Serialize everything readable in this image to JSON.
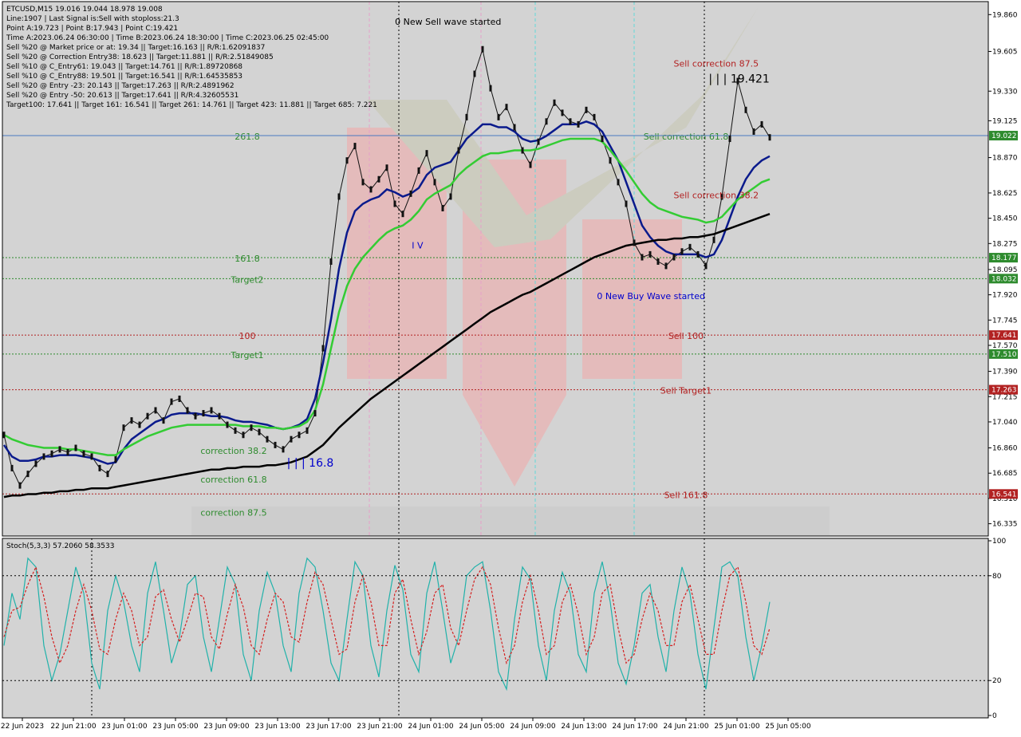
{
  "header": {
    "symbol_line": "ETCUSD,M15  19.016 19.044 18.978 19.008",
    "info_lines": [
      "Line:1907 | Last Signal is:Sell with stoploss:21.3",
      "Point A:19.723 | Point B:17.943 | Point C:19.421",
      "Time A:2023.06.24 06:30:00 | Time B:2023.06.24 18:30:00 | Time C:2023.06.25 02:45:00",
      "Sell %20 @ Market price or at: 19.34 || Target:16.163 || R/R:1.62091837",
      "Sell %20 @ Correction Entry38: 18.623 || Target:11.881 || R/R:2.51849085",
      "Sell %10 @ C_Entry61: 19.043 || Target:14.761 || R/R:1.89720868",
      "Sell %10 @ C_Entry88: 19.501 || Target:16.541 || R/R:1.64535853",
      "Sell %20 @ Entry -23: 20.143 || Target:17.263 || R/R:2.4891962",
      "Sell %20 @ Entry -50: 20.613 || Target:17.641 || R/R:4.32605531",
      "Target100: 17.641 || Target 161: 16.541 || Target 261: 14.761 || Target 423: 11.881 || Target 685: 7.221"
    ]
  },
  "colors": {
    "background": "#d3d3d3",
    "price_line": "#4a78c0",
    "sell_level": "#b22222",
    "buy_level": "#2e8b2e",
    "ma_fast": "#0a1a8c",
    "ma_mid": "#33cc33",
    "ma_slow": "#000000",
    "stoch_main": "#20b2aa",
    "stoch_signal": "#d42020"
  },
  "chart_data": [
    {
      "type": "line",
      "title": "ETCUSD,M15",
      "ylim": [
        16.25,
        19.95
      ],
      "y_ticks": [
        "19.860",
        "19.605",
        "19.330",
        "19.125",
        "18.870",
        "18.625",
        "18.450",
        "18.275",
        "18.095",
        "17.920",
        "17.745",
        "17.570",
        "17.390",
        "17.215",
        "17.040",
        "16.860",
        "16.685",
        "16.510",
        "16.335"
      ],
      "x_ticks": [
        "22 Jun 2023",
        "22 Jun 21:00",
        "23 Jun 01:00",
        "23 Jun 05:00",
        "23 Jun 09:00",
        "23 Jun 13:00",
        "23 Jun 17:00",
        "23 Jun 21:00",
        "24 Jun 01:00",
        "24 Jun 05:00",
        "24 Jun 09:00",
        "24 Jun 13:00",
        "24 Jun 17:00",
        "24 Jun 21:00",
        "25 Jun 01:00",
        "25 Jun 05:00"
      ],
      "current_price": 19.022,
      "price_tags": [
        {
          "value": 19.022,
          "label": "19.022",
          "kind": "buy"
        },
        {
          "value": 18.177,
          "label": "18.177",
          "kind": "buy"
        },
        {
          "value": 18.032,
          "label": "18.032",
          "kind": "buy"
        },
        {
          "value": 17.641,
          "label": "17.641",
          "kind": "sell"
        },
        {
          "value": 17.51,
          "label": "17.510",
          "kind": "buy"
        },
        {
          "value": 17.263,
          "label": "17.263",
          "kind": "sell"
        },
        {
          "value": 16.541,
          "label": "16.541",
          "kind": "sell"
        }
      ],
      "levels": [
        {
          "value": 19.022,
          "left_label": "261.8",
          "right_label": "Sell correction 61.8",
          "kind": "buy"
        },
        {
          "value": 18.177,
          "left_label": "161.8",
          "right_label": "",
          "kind": "buy"
        },
        {
          "value": 18.032,
          "left_label": "Target2",
          "right_label": "",
          "kind": "buy"
        },
        {
          "value": 17.641,
          "left_label": "100",
          "right_label": "Sell 100",
          "kind": "sell"
        },
        {
          "value": 17.51,
          "left_label": "Target1",
          "right_label": "",
          "kind": "buy"
        },
        {
          "value": 17.263,
          "left_label": "",
          "right_label": "Sell Target1",
          "kind": "sell"
        },
        {
          "value": 16.541,
          "left_label": "",
          "right_label": "Sell 161.8",
          "kind": "sell"
        }
      ],
      "annotations": [
        {
          "text": "0 New Sell wave started",
          "x": 58,
          "y": 19.79,
          "color": "#000000"
        },
        {
          "text": "Sell correction 87.5",
          "x": 93,
          "y": 19.5,
          "color": "#b22222"
        },
        {
          "text": "| | | 19.421",
          "x": 96,
          "y": 19.39,
          "color": "#000000"
        },
        {
          "text": "Sell correction 38.2",
          "x": 93,
          "y": 18.59,
          "color": "#b22222"
        },
        {
          "text": "0 New Buy Wave started",
          "x": 84.5,
          "y": 17.89,
          "color": "#0000cc"
        },
        {
          "text": "correction 38.2",
          "x": 30,
          "y": 16.82,
          "color": "#2e8b2e"
        },
        {
          "text": "correction 61.8",
          "x": 30,
          "y": 16.62,
          "color": "#2e8b2e"
        },
        {
          "text": "correction 87.5",
          "x": 30,
          "y": 16.39,
          "color": "#2e8b2e"
        },
        {
          "text": "| | | 16.8",
          "x": 40,
          "y": 16.73,
          "color": "#0000cc"
        },
        {
          "text": "I V",
          "x": 54,
          "y": 18.24,
          "color": "#0000cc"
        }
      ],
      "series": [
        {
          "name": "price",
          "values": [
            16.95,
            16.72,
            16.6,
            16.68,
            16.75,
            16.8,
            16.82,
            16.85,
            16.83,
            16.86,
            16.82,
            16.8,
            16.72,
            16.68,
            16.78,
            17.0,
            17.05,
            17.02,
            17.08,
            17.12,
            17.05,
            17.18,
            17.2,
            17.12,
            17.08,
            17.1,
            17.12,
            17.08,
            17.02,
            16.98,
            16.95,
            17.0,
            16.97,
            16.92,
            16.88,
            16.85,
            16.92,
            16.95,
            16.98,
            17.1,
            17.55,
            18.15,
            18.6,
            18.85,
            18.95,
            18.7,
            18.65,
            18.72,
            18.8,
            18.55,
            18.48,
            18.62,
            18.78,
            18.9,
            18.7,
            18.52,
            18.6,
            18.92,
            19.15,
            19.45,
            19.62,
            19.35,
            19.15,
            19.22,
            19.08,
            18.92,
            18.82,
            18.98,
            19.12,
            19.25,
            19.18,
            19.12,
            19.1,
            19.2,
            19.15,
            19.0,
            18.85,
            18.7,
            18.55,
            18.28,
            18.18,
            18.2,
            18.15,
            18.12,
            18.18,
            18.22,
            18.25,
            18.2,
            18.12,
            18.3,
            18.6,
            19.0,
            19.4,
            19.2,
            19.05,
            19.1,
            19.01
          ]
        },
        {
          "name": "ma_fast",
          "values": [
            16.88,
            16.8,
            16.77,
            16.77,
            16.78,
            16.8,
            16.8,
            16.81,
            16.81,
            16.81,
            16.8,
            16.79,
            16.77,
            16.75,
            16.76,
            16.85,
            16.92,
            16.96,
            17.0,
            17.04,
            17.06,
            17.09,
            17.1,
            17.1,
            17.1,
            17.09,
            17.08,
            17.08,
            17.07,
            17.05,
            17.04,
            17.04,
            17.03,
            17.02,
            17.0,
            16.99,
            17.0,
            17.02,
            17.06,
            17.2,
            17.45,
            17.75,
            18.1,
            18.35,
            18.5,
            18.55,
            18.58,
            18.6,
            18.65,
            18.63,
            18.6,
            18.62,
            18.66,
            18.75,
            18.8,
            18.82,
            18.84,
            18.92,
            19.0,
            19.05,
            19.1,
            19.1,
            19.08,
            19.08,
            19.05,
            19.0,
            18.98,
            18.99,
            19.02,
            19.06,
            19.1,
            19.1,
            19.1,
            19.12,
            19.1,
            19.05,
            18.95,
            18.85,
            18.7,
            18.55,
            18.4,
            18.32,
            18.26,
            18.22,
            18.2,
            18.2,
            18.2,
            18.2,
            18.18,
            18.2,
            18.3,
            18.45,
            18.6,
            18.72,
            18.8,
            18.85,
            18.88
          ]
        },
        {
          "name": "ma_mid",
          "values": [
            16.95,
            16.92,
            16.9,
            16.88,
            16.87,
            16.86,
            16.86,
            16.86,
            16.85,
            16.85,
            16.84,
            16.83,
            16.82,
            16.81,
            16.81,
            16.85,
            16.88,
            16.91,
            16.94,
            16.96,
            16.98,
            17.0,
            17.01,
            17.02,
            17.02,
            17.02,
            17.02,
            17.02,
            17.02,
            17.02,
            17.01,
            17.01,
            17.01,
            17.0,
            17.0,
            16.99,
            17.0,
            17.01,
            17.04,
            17.12,
            17.3,
            17.55,
            17.8,
            17.98,
            18.1,
            18.18,
            18.24,
            18.3,
            18.35,
            18.38,
            18.4,
            18.44,
            18.5,
            18.58,
            18.62,
            18.65,
            18.68,
            18.75,
            18.8,
            18.84,
            18.88,
            18.9,
            18.9,
            18.91,
            18.92,
            18.92,
            18.92,
            18.93,
            18.95,
            18.97,
            18.99,
            19.0,
            19.0,
            19.0,
            19.0,
            18.98,
            18.92,
            18.85,
            18.78,
            18.7,
            18.62,
            18.56,
            18.52,
            18.5,
            18.48,
            18.46,
            18.45,
            18.44,
            18.42,
            18.43,
            18.46,
            18.52,
            18.58,
            18.62,
            18.66,
            18.7,
            18.72
          ]
        },
        {
          "name": "ma_slow",
          "values": [
            16.52,
            16.53,
            16.53,
            16.54,
            16.54,
            16.55,
            16.55,
            16.56,
            16.56,
            16.57,
            16.57,
            16.58,
            16.58,
            16.58,
            16.59,
            16.6,
            16.61,
            16.62,
            16.63,
            16.64,
            16.65,
            16.66,
            16.67,
            16.68,
            16.69,
            16.7,
            16.71,
            16.71,
            16.72,
            16.72,
            16.73,
            16.73,
            16.73,
            16.74,
            16.74,
            16.75,
            16.76,
            16.78,
            16.8,
            16.84,
            16.88,
            16.94,
            17.0,
            17.05,
            17.1,
            17.15,
            17.2,
            17.24,
            17.28,
            17.32,
            17.36,
            17.4,
            17.44,
            17.48,
            17.52,
            17.56,
            17.6,
            17.64,
            17.68,
            17.72,
            17.76,
            17.8,
            17.83,
            17.86,
            17.89,
            17.92,
            17.94,
            17.97,
            18.0,
            18.03,
            18.06,
            18.09,
            18.12,
            18.15,
            18.18,
            18.2,
            18.22,
            18.24,
            18.26,
            18.27,
            18.28,
            18.29,
            18.3,
            18.3,
            18.31,
            18.31,
            18.32,
            18.32,
            18.33,
            18.34,
            18.36,
            18.38,
            18.4,
            18.42,
            18.44,
            18.46,
            18.48
          ]
        }
      ]
    },
    {
      "type": "line",
      "title": "Stoch(5,3,3) 57.2060 58.3533",
      "ylim": [
        0,
        100
      ],
      "y_ticks": [
        "100",
        "80",
        "20",
        "0"
      ],
      "levels": [
        80,
        20
      ],
      "series": [
        {
          "name": "main",
          "values": [
            40,
            70,
            55,
            90,
            85,
            40,
            20,
            35,
            60,
            85,
            70,
            30,
            15,
            60,
            80,
            65,
            40,
            25,
            70,
            88,
            60,
            30,
            45,
            75,
            80,
            45,
            25,
            55,
            85,
            75,
            35,
            20,
            60,
            82,
            70,
            40,
            25,
            70,
            90,
            85,
            60,
            30,
            20,
            55,
            88,
            80,
            40,
            22,
            60,
            86,
            72,
            35,
            25,
            70,
            88,
            60,
            30,
            45,
            80,
            85,
            88,
            60,
            25,
            15,
            55,
            85,
            78,
            40,
            20,
            60,
            82,
            70,
            35,
            25,
            70,
            88,
            65,
            30,
            18,
            40,
            70,
            75,
            45,
            25,
            60,
            85,
            70,
            35,
            15,
            50,
            85,
            88,
            80,
            45,
            20,
            40,
            65
          ]
        },
        {
          "name": "signal",
          "values": [
            45,
            60,
            62,
            75,
            85,
            68,
            45,
            30,
            40,
            60,
            75,
            60,
            38,
            35,
            55,
            70,
            60,
            40,
            45,
            68,
            72,
            55,
            42,
            55,
            70,
            68,
            45,
            38,
            58,
            75,
            62,
            40,
            35,
            55,
            70,
            65,
            45,
            42,
            65,
            82,
            75,
            55,
            35,
            38,
            65,
            80,
            65,
            40,
            40,
            70,
            78,
            55,
            35,
            48,
            70,
            75,
            50,
            40,
            60,
            78,
            85,
            75,
            50,
            30,
            40,
            65,
            80,
            60,
            35,
            40,
            65,
            75,
            58,
            35,
            45,
            70,
            75,
            50,
            30,
            35,
            55,
            70,
            60,
            40,
            40,
            65,
            75,
            55,
            35,
            35,
            60,
            80,
            85,
            65,
            40,
            35,
            50
          ]
        }
      ]
    }
  ]
}
